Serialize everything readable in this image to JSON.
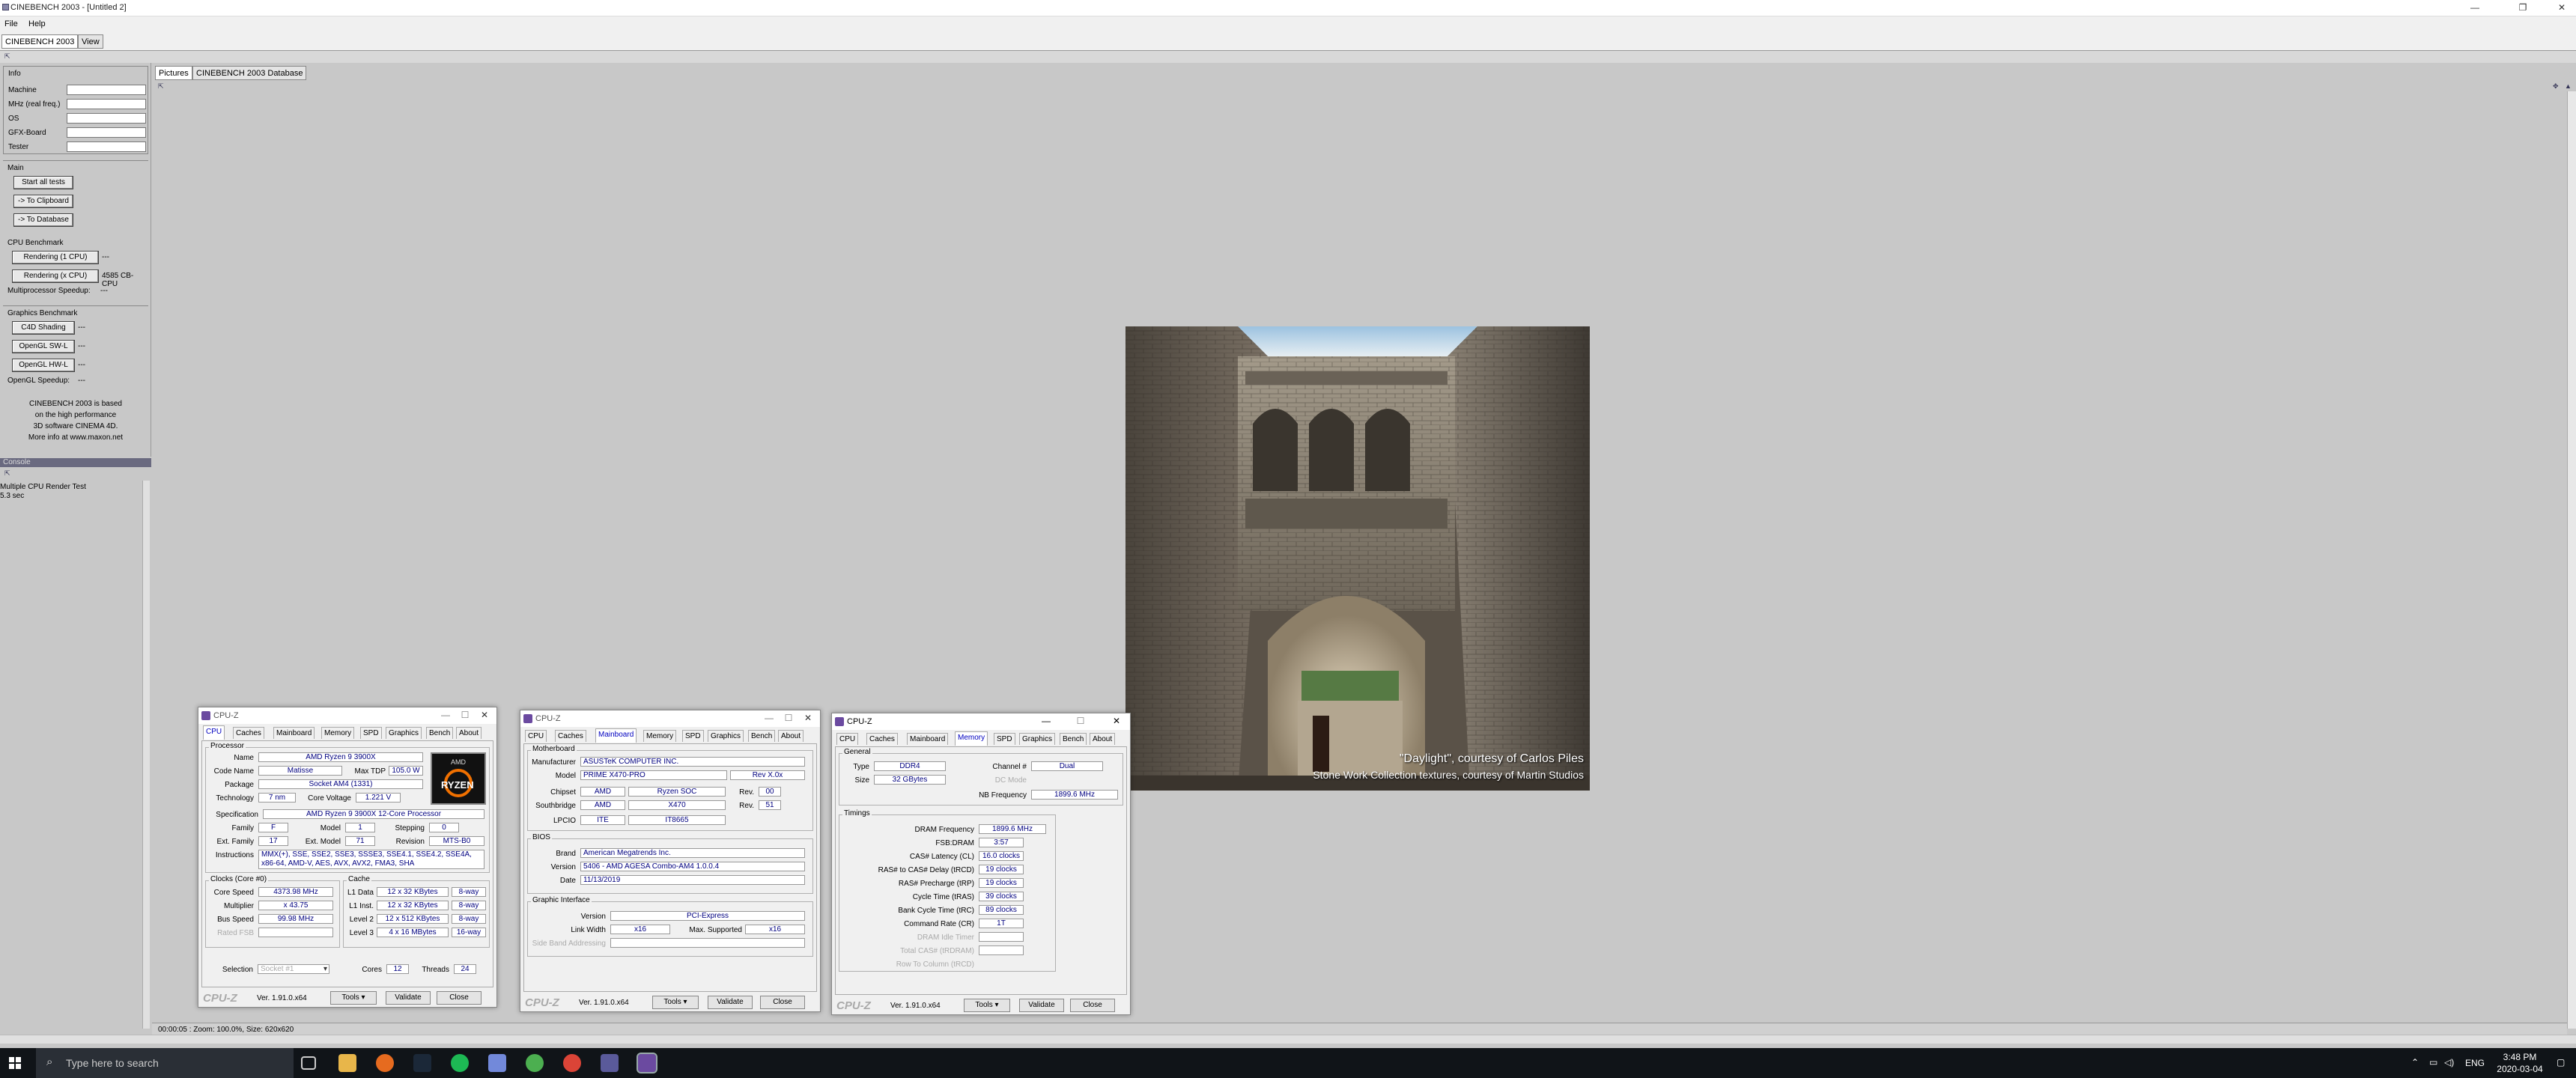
{
  "window": {
    "title": "CINEBENCH 2003 - [Untitled 2]",
    "minimize": "—",
    "maximize": "❐",
    "close": "✕"
  },
  "menu": {
    "file": "File",
    "help": "Help"
  },
  "top_tabs": [
    "CINEBENCH 2003",
    "View"
  ],
  "info": {
    "heading": "Info",
    "labels": [
      "Machine",
      "MHz (real freq.)",
      "OS",
      "GFX-Board",
      "Tester"
    ]
  },
  "main": {
    "heading": "Main",
    "start": "Start all tests",
    "clipboard": "-> To Clipboard",
    "database": "-> To Database"
  },
  "cpu_bench": {
    "heading": "CPU Benchmark",
    "r1": "Rendering (1 CPU)",
    "r1_val": "---",
    "rx": "Rendering (x CPU)",
    "rx_val": "4585 CB-CPU",
    "mp": "Multiprocessor Speedup:",
    "mp_val": "---"
  },
  "gfx_bench": {
    "heading": "Graphics Benchmark",
    "c4d": "C4D Shading",
    "sw": "OpenGL SW-L",
    "hw": "OpenGL HW-L",
    "dash": "---",
    "speedup": "OpenGL Speedup:",
    "speedup_val": "---"
  },
  "about_note": [
    "CINEBENCH 2003 is based",
    "on the high performance",
    "3D software CINEMA 4D.",
    "More info at www.maxon.net"
  ],
  "console": {
    "heading": "Console",
    "line1": "Multiple CPU Render Test",
    "line2": "5.3 sec"
  },
  "view_tabs": [
    "Pictures",
    "CINEBENCH 2003 Database"
  ],
  "render": {
    "credit1": "\"Daylight\", courtesy of Carlos Piles",
    "credit2": "Stone Work Collection textures, courtesy of Martin Studios"
  },
  "status": "00:00:05 : Zoom: 100.0%, Size: 620x620",
  "taskbar": {
    "search": "Type here to search",
    "time": "3:48 PM",
    "date": "2020-03-04",
    "lang": "ENG"
  },
  "cpuz_common": {
    "title": "CPU-Z",
    "logo": "CPU-Z",
    "version": "Ver. 1.91.0.x64",
    "tools": "Tools",
    "validate": "Validate",
    "close": "Close",
    "tabs": [
      "CPU",
      "Caches",
      "Mainboard",
      "Memory",
      "SPD",
      "Graphics",
      "Bench",
      "About"
    ]
  },
  "cpuz1": {
    "processor": "Processor",
    "name_l": "Name",
    "name": "AMD Ryzen 9 3900X",
    "code_l": "Code Name",
    "code": "Matisse",
    "tdp_l": "Max TDP",
    "tdp": "105.0 W",
    "pkg_l": "Package",
    "pkg": "Socket AM4 (1331)",
    "tech_l": "Technology",
    "tech": "7 nm",
    "cv_l": "Core Voltage",
    "cv": "1.221 V",
    "spec_l": "Specification",
    "spec": "AMD Ryzen 9 3900X 12-Core Processor",
    "fam_l": "Family",
    "fam": "F",
    "model_l": "Model",
    "model": "1",
    "step_l": "Stepping",
    "step": "0",
    "efam_l": "Ext. Family",
    "efam": "17",
    "emodel_l": "Ext. Model",
    "emodel": "71",
    "rev_l": "Revision",
    "rev": "MTS-B0",
    "inst_l": "Instructions",
    "inst": "MMX(+), SSE, SSE2, SSE3, SSSE3, SSE4.1, SSE4.2, SSE4A, x86-64, AMD-V, AES, AVX, AVX2, FMA3, SHA",
    "clocks": "Clocks (Core #0)",
    "cs_l": "Core Speed",
    "cs": "4373.98 MHz",
    "mul_l": "Multiplier",
    "mul": "x 43.75",
    "bus_l": "Bus Speed",
    "bus": "99.98 MHz",
    "fsb_l": "Rated FSB",
    "cache": "Cache",
    "l1d_l": "L1 Data",
    "l1d": "12 x 32 KBytes",
    "l1d_w": "8-way",
    "l1i_l": "L1 Inst.",
    "l1i": "12 x 32 KBytes",
    "l1i_w": "8-way",
    "l2_l": "Level 2",
    "l2": "12 x 512 KBytes",
    "l2_w": "8-way",
    "l3_l": "Level 3",
    "l3": "4 x 16 MBytes",
    "l3_w": "16-way",
    "sel_l": "Selection",
    "sel": "Socket #1",
    "cores_l": "Cores",
    "cores": "12",
    "thr_l": "Threads",
    "thr": "24",
    "badge": "RYZEN",
    "badge_top": "AMD"
  },
  "cpuz2": {
    "mb": "Motherboard",
    "man_l": "Manufacturer",
    "man": "ASUSTeK COMPUTER INC.",
    "mod_l": "Model",
    "mod": "PRIME X470-PRO",
    "mod_rev": "Rev X.0x",
    "chip_l": "Chipset",
    "chip1": "AMD",
    "chip2": "Ryzen SOC",
    "rev_l": "Rev.",
    "chip_rev": "00",
    "sb_l": "Southbridge",
    "sb1": "AMD",
    "sb2": "X470",
    "sb_rev": "51",
    "lpc_l": "LPCIO",
    "lpc1": "ITE",
    "lpc2": "IT8665",
    "bios": "BIOS",
    "brand_l": "Brand",
    "brand": "American Megatrends Inc.",
    "ver_l": "Version",
    "ver": "5406 - AMD AGESA Combo-AM4 1.0.0.4",
    "date_l": "Date",
    "date": "11/13/2019",
    "gi": "Graphic Interface",
    "giv_l": "Version",
    "giv": "PCI-Express",
    "lw_l": "Link Width",
    "lw": "x16",
    "ms_l": "Max. Supported",
    "ms": "x16",
    "sba_l": "Side Band Addressing"
  },
  "cpuz3": {
    "gen": "General",
    "type_l": "Type",
    "type": "DDR4",
    "ch_l": "Channel #",
    "ch": "Dual",
    "size_l": "Size",
    "size": "32 GBytes",
    "dc_l": "DC Mode",
    "nb_l": "NB Frequency",
    "nb": "1899.6 MHz",
    "tim": "Timings",
    "df_l": "DRAM Frequency",
    "df": "1899.6 MHz",
    "fsb_l": "FSB:DRAM",
    "fsb": "3:57",
    "cl_l": "CAS# Latency (CL)",
    "cl": "16.0 clocks",
    "rcd_l": "RAS# to CAS# Delay (tRCD)",
    "rcd": "19 clocks",
    "rp_l": "RAS# Precharge (tRP)",
    "rp": "19 clocks",
    "ras_l": "Cycle Time (tRAS)",
    "ras": "39 clocks",
    "rc_l": "Bank Cycle Time (tRC)",
    "rc": "89 clocks",
    "cr_l": "Command Rate (CR)",
    "cr": "1T",
    "idle_l": "DRAM Idle Timer",
    "trdram_l": "Total CAS# (tRDRAM)",
    "rtc_l": "Row To Column (tRCD)"
  }
}
